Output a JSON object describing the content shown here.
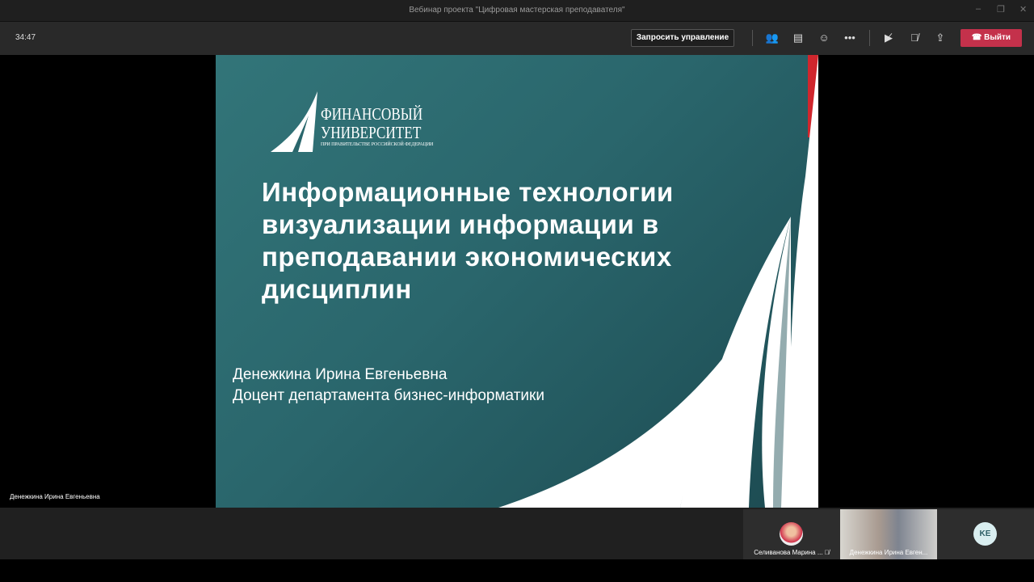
{
  "window": {
    "title": "Вебинар проекта \"Цифровая мастерская преподавателя\""
  },
  "toolbar": {
    "timer": "34:47",
    "request_control": "Запросить управление",
    "leave": "Выйти"
  },
  "slide": {
    "logo": {
      "line1": "ФИНАНСОВЫЙ",
      "line2": "УНИВЕРСИТЕТ",
      "line3": "ПРИ ПРАВИТЕЛЬСТВЕ РОССИЙСКОЙ ФЕДЕРАЦИИ"
    },
    "title": "Информационные технологии визуализации информации в преподавании экономических дисциплин",
    "author": "Денежкина Ирина Евгеньевна",
    "position": "Доцент департамента бизнес-информатики"
  },
  "speaker_label": "Денежкина Ирина Евгеньевна",
  "participants": [
    {
      "name": "Селиванова Марина ..."
    },
    {
      "name": "Денежкина Ирина Евген..."
    },
    {
      "initials": "KE"
    }
  ],
  "colors": {
    "leave": "#c4314b",
    "slide": "#2a666c"
  }
}
